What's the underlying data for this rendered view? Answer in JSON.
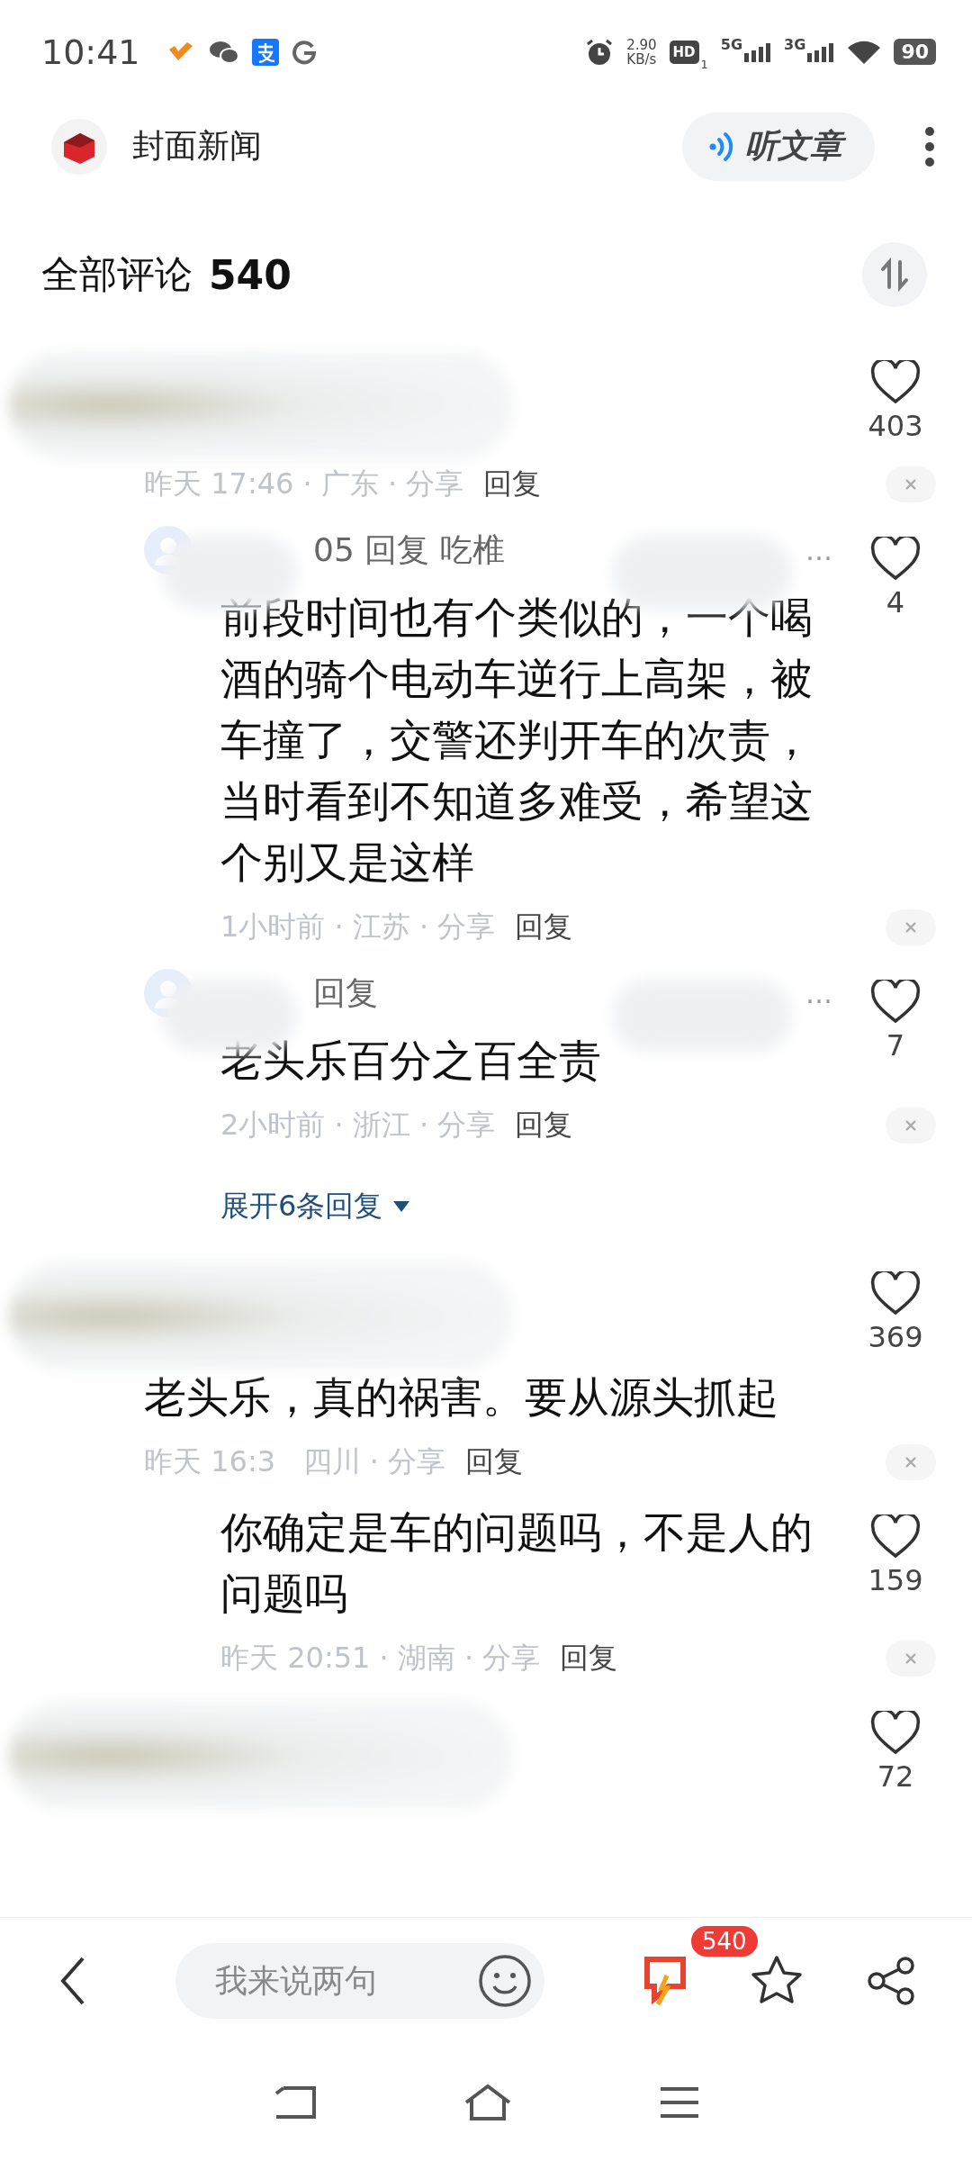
{
  "status_bar": {
    "time": "10:41",
    "net_speed": "2.90",
    "net_unit": "KB/s",
    "hd": "HD",
    "hd_sub": "1",
    "sim_1": "5G",
    "sim_2": "3G",
    "battery": "90"
  },
  "app_bar": {
    "title": "封面新闻",
    "listen_button": "听文章"
  },
  "header": {
    "label": "全部评论",
    "count": "540"
  },
  "comments": [
    {
      "kind": "top",
      "likes": "403",
      "meta": "昨天 17:46 · 广东 · 分享",
      "reply": "回复"
    },
    {
      "kind": "reply",
      "header": "05 回复 吃椎",
      "more": "…",
      "text": "前段时间也有个类似的，一个喝酒的骑个电动车逆行上高架，被车撞了，交警还判开车的次责，当时看到不知道多难受，希望这个别又是这样",
      "likes": "4",
      "meta": "1小时前 · 江苏 · 分享",
      "reply": "回复"
    },
    {
      "kind": "reply",
      "header": "回复",
      "more": "…",
      "text": "老头乐百分之百全责",
      "likes": "7",
      "meta": "2小时前 · 浙江 · 分享",
      "reply": "回复",
      "expand": "展开6条回复"
    },
    {
      "kind": "top",
      "text": "老头乐，真的祸害。要从源头抓起",
      "likes": "369",
      "meta": "昨天 16:3   四川 · 分享",
      "reply": "回复"
    },
    {
      "kind": "reply",
      "text": "你确定是车的问题吗，不是人的问题吗",
      "likes": "159",
      "meta": "昨天 20:51 · 湖南 · 分享",
      "reply": "回复"
    },
    {
      "kind": "top",
      "likes": "72"
    }
  ],
  "bottom_bar": {
    "placeholder": "我来说两句",
    "comment_count": "540"
  }
}
